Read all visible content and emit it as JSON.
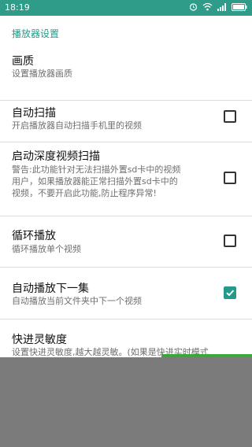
{
  "status_bar": {
    "time": "18:19",
    "icons": [
      "alarm-icon",
      "wifi-icon",
      "signal-icon",
      "battery-icon"
    ],
    "bg_color": "#2f9c89"
  },
  "settings": {
    "section_header": "播放器设置",
    "items": [
      {
        "title": "画质",
        "summary": [
          "设置播放器画质"
        ],
        "checkbox": null
      },
      {
        "title": "自动扫描",
        "summary": [
          "开启播放器自动扫描手机里的视频"
        ],
        "checkbox": false
      },
      {
        "title": "启动深度视频扫描",
        "summary": [
          "警告:此功能针对无法扫描外置sd卡中的视频",
          "用户，如果播放器能正常扫描外置sd卡中的",
          "视频，不要开启此功能,防止程序异常!"
        ],
        "checkbox": false
      },
      {
        "title": "循环播放",
        "summary": [
          "循环播放单个视频"
        ],
        "checkbox": false
      },
      {
        "title": "自动播放下一集",
        "summary": [
          "自动播放当前文件夹中下一个视频"
        ],
        "checkbox": true
      },
      {
        "title": "快进灵敏度",
        "summary": [
          "设置快进灵敏度,越大越灵敏。(如果是快进实时模式"
        ],
        "checkbox": null
      }
    ]
  },
  "colors": {
    "accent": "#239a8a",
    "overlay": "#7b7b7b"
  }
}
